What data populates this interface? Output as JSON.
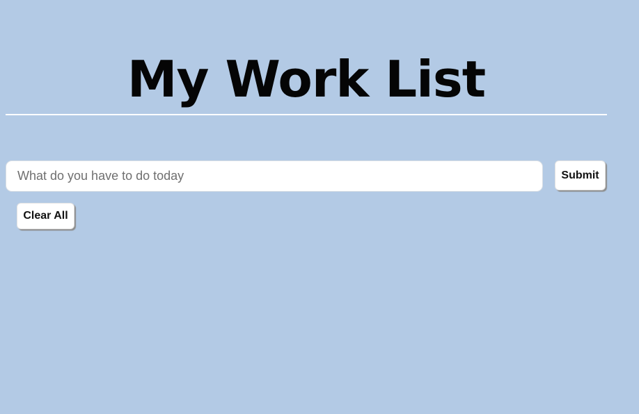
{
  "header": {
    "title": "My Work List"
  },
  "form": {
    "placeholder": "What do you have to do today",
    "submit_label": "Submit",
    "clear_label": "Clear All"
  },
  "colors": {
    "background": "#b3cae5",
    "divider": "#ffffff",
    "button_background": "#ffffff",
    "title_text": "#050505"
  }
}
